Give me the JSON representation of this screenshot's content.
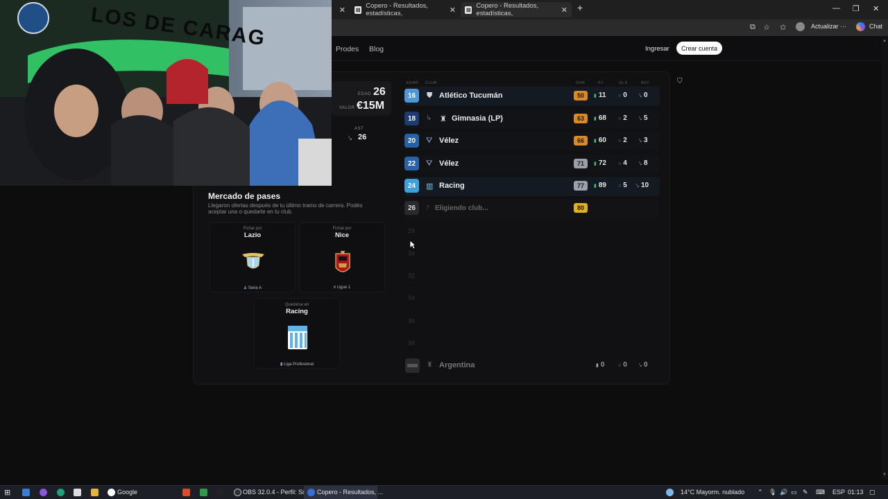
{
  "browser": {
    "tabs": [
      {
        "label": "Copero - Resultados, estadísticas,",
        "active": false
      },
      {
        "label": "Copero - Resultados, estadísticas,",
        "active": true
      }
    ],
    "new_tab": "+",
    "minimize": "—",
    "restore": "❐",
    "close": "✕",
    "update_label": "Actualizar",
    "chat_label": "Chat"
  },
  "site": {
    "nav": [
      "Prodes",
      "Blog"
    ],
    "login": "Ingresar",
    "signup": "Crear cuenta"
  },
  "profile": {
    "age_label": "EDAD",
    "age": "26",
    "value_label": "VALOR",
    "value": "€15M",
    "ast_label": "AST",
    "ast": "26"
  },
  "career": {
    "headers": {
      "edad": "EDAD",
      "club": "CLUB",
      "ovr": "OVR",
      "pj": "PJ",
      "gls": "GLS",
      "ast": "AST"
    },
    "rows": [
      {
        "age": "16",
        "club": "Atlético Tucumán",
        "ovr": "50",
        "pj": "11",
        "gls": "0",
        "ast": "0",
        "age_color": "#4f97d6",
        "ovr_color": "#d98a22"
      },
      {
        "age": "18",
        "club": "Gimnasia (LP)",
        "ovr": "63",
        "pj": "68",
        "gls": "2",
        "ast": "5",
        "age_color": "#1e3a72",
        "ovr_color": "#d98a22"
      },
      {
        "age": "20",
        "club": "Vélez",
        "ovr": "66",
        "pj": "60",
        "gls": "2",
        "ast": "3",
        "age_color": "#2860a8",
        "ovr_color": "#d98a22"
      },
      {
        "age": "22",
        "club": "Vélez",
        "ovr": "71",
        "pj": "72",
        "gls": "4",
        "ast": "8",
        "age_color": "#2a62a8",
        "ovr_color": "#9a9fa8"
      },
      {
        "age": "24",
        "club": "Racing",
        "ovr": "77",
        "pj": "89",
        "gls": "5",
        "ast": "10",
        "age_color": "#3fa0d6",
        "ovr_color": "#9a9fa8"
      }
    ],
    "pending": {
      "age": "26",
      "label": "Eligiendo club...",
      "ovr": "80"
    },
    "future_ages": [
      "28",
      "30",
      "32",
      "34",
      "36",
      "38"
    ],
    "national": {
      "club": "Argentina",
      "pj": "0",
      "gls": "0",
      "ast": "0"
    }
  },
  "market": {
    "title": "Mercado de pases",
    "description": "Llegaron ofertas después de tu último tramo de carrera. Podés aceptar una o quedarte en tu club.",
    "offers": [
      {
        "prefix": "Fichar por",
        "club": "Lazio",
        "league": "Serie A"
      },
      {
        "prefix": "Fichar por",
        "club": "Nice",
        "league": "Ligue 1"
      },
      {
        "prefix": "Quedarse en",
        "club": "Racing",
        "league": "Liga Profesional"
      }
    ]
  },
  "webcam": {
    "banner_text": "LOS DE CARAG"
  },
  "taskbar": {
    "google": "Google",
    "obs": "OBS 32.0.4 - Perfil: Sin...",
    "copero": "Copero - Resultados, ...",
    "weather": "14°C  Mayorm. nublado",
    "lang": "ESP",
    "time": "01:13"
  }
}
